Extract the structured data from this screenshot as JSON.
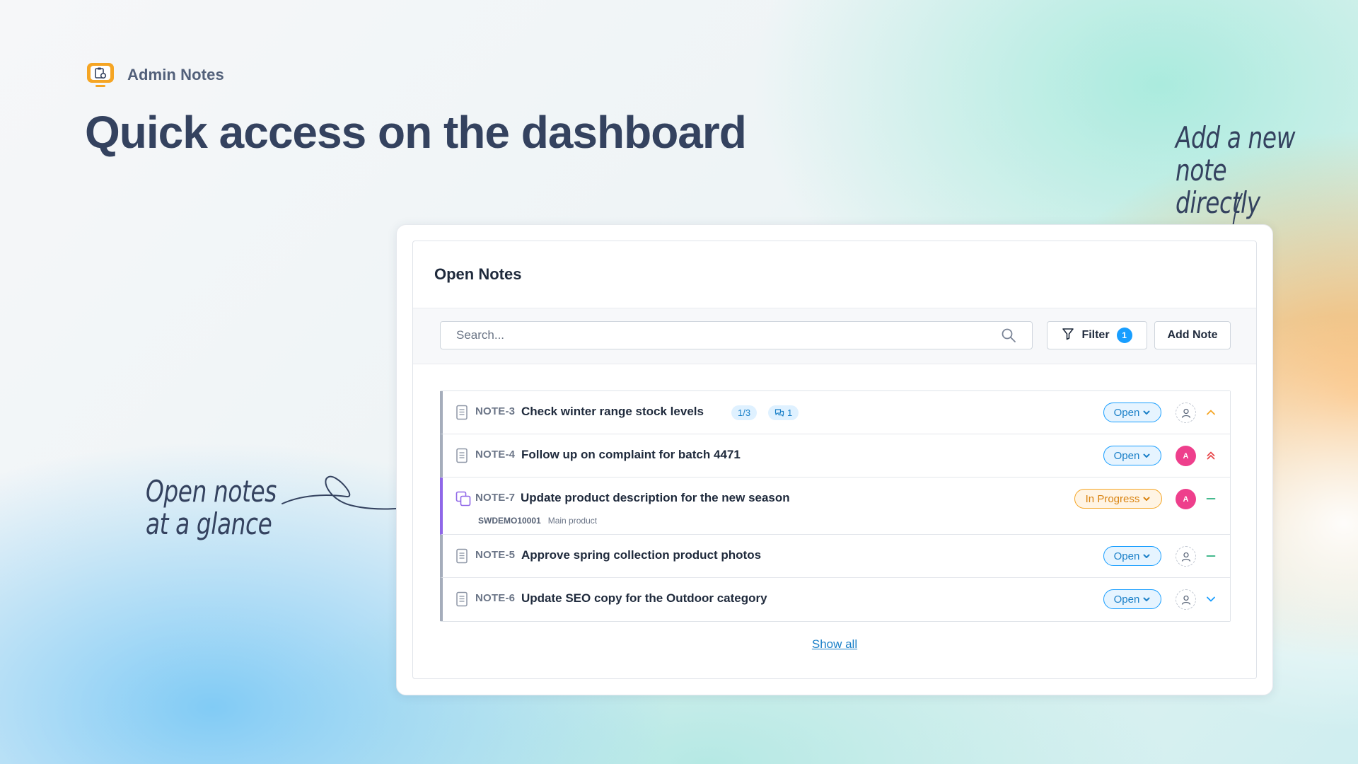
{
  "brand": {
    "name": "Admin Notes",
    "accent": "#f5a524"
  },
  "headline": "Quick access on the dashboard",
  "annotations": {
    "right_line1": "Add a new",
    "right_line2": "note directly",
    "left_line1": "Open notes",
    "left_line2": "at a glance"
  },
  "card": {
    "title": "Open Notes",
    "search": {
      "placeholder": "Search...",
      "value": ""
    },
    "filter": {
      "label": "Filter",
      "count": "1"
    },
    "add_note_label": "Add Note",
    "show_all_label": "Show all"
  },
  "notes": [
    {
      "id": "NOTE-3",
      "title": "Check winter range stock levels",
      "tasks": "1/3",
      "comments": "1",
      "status": "Open",
      "assignee": "",
      "priority": "high"
    },
    {
      "id": "NOTE-4",
      "title": "Follow up on complaint for batch 4471",
      "status": "Open",
      "assignee": "A",
      "priority": "highest"
    },
    {
      "id": "NOTE-7",
      "title": "Update product description for the new season",
      "sku": "SWDEMO10001",
      "product": "Main product",
      "status": "In Progress",
      "assignee": "A",
      "priority": "medium"
    },
    {
      "id": "NOTE-5",
      "title": "Approve spring collection product photos",
      "status": "Open",
      "assignee": "",
      "priority": "medium"
    },
    {
      "id": "NOTE-6",
      "title": "Update SEO copy for the Outdoor category",
      "status": "Open",
      "assignee": "",
      "priority": "low"
    }
  ],
  "colors": {
    "open": "#189eff",
    "in_progress": "#f5a524",
    "avatar": "#ee3f8c",
    "variant_marker": "#8f67e8"
  }
}
